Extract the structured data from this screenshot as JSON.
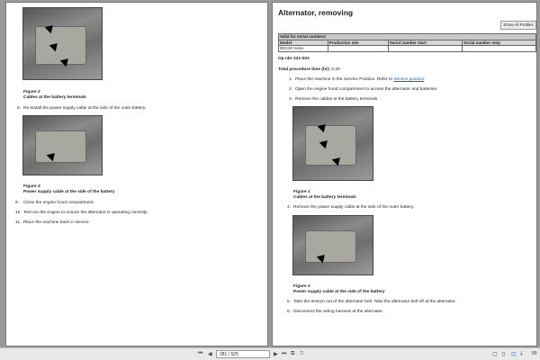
{
  "left_page": {
    "figure2": {
      "label": "Figure 2",
      "caption": "Cables at the battery terminals"
    },
    "step8": {
      "num": "8.",
      "text": "Re-install the power supply cable at the side of the outer battery."
    },
    "figure3": {
      "label": "Figure 3",
      "caption": "Power supply cable at the side of the battery"
    },
    "steps": [
      {
        "num": "9.",
        "text": "Close the engine hood compartment."
      },
      {
        "num": "10.",
        "text": "Test run the engine to ensure the alternator is operating correctly."
      },
      {
        "num": "11.",
        "text": "Place the machine back in service."
      }
    ]
  },
  "right_page": {
    "title": "Alternator, removing",
    "show_profiles": "Show All Profiles",
    "table": {
      "caption": "Valid for serial numbers",
      "headers": [
        "Model",
        "Production site",
        "Serial number start",
        "Serial number stop"
      ],
      "row": [
        "DD120 Volvo",
        "",
        "",
        ""
      ]
    },
    "op_nbr": "Op nbr 321-003",
    "time_label": "Total procedure time (hr):",
    "time_value": "0.30",
    "step1": {
      "num": "1.",
      "text": "Place the machine in the Service Position. Refer to ",
      "link": "Service position",
      "end": "."
    },
    "steps_a": [
      {
        "num": "2.",
        "text": "Open the engine hood compartment to access the alternator and batteries."
      },
      {
        "num": "3.",
        "text": "Remove the cables at the battery terminals."
      }
    ],
    "figure1": {
      "label": "Figure 1",
      "caption": "Cables at the battery terminals"
    },
    "step4": {
      "num": "4.",
      "text": "Remove the power supply cable at the side of the outer battery."
    },
    "figure2": {
      "label": "Figure 2",
      "caption": "Power supply cable at the side of the battery"
    },
    "steps_b": [
      {
        "num": "5.",
        "text": "Take the tension out of the alternator belt. Take the alternator belt off at the alternator."
      },
      {
        "num": "6.",
        "text": "Disconnect the wiring harness at the alternator."
      }
    ]
  },
  "toolbar": {
    "page_indicator": "281 / 525",
    "zoom": "89"
  }
}
